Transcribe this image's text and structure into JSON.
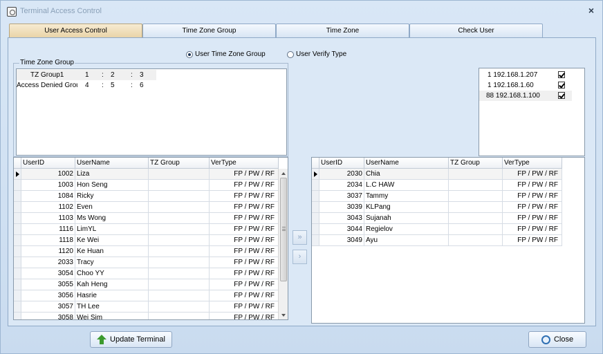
{
  "window": {
    "title": "Terminal Access Control"
  },
  "tabs": [
    {
      "label": "User Access Control",
      "active": true
    },
    {
      "label": "Time Zone Group",
      "active": false
    },
    {
      "label": "Time Zone",
      "active": false
    },
    {
      "label": "Check User",
      "active": false
    }
  ],
  "radios": {
    "tz_group": {
      "label": "User Time Zone Group",
      "selected": true
    },
    "verify_type": {
      "label": "User Verify Type",
      "selected": false
    }
  },
  "time_zone_group": {
    "label": "Time Zone Group",
    "rows": [
      {
        "name": "TZ Group1",
        "a": "1",
        "sep1": ":",
        "b": "2",
        "sep2": ":",
        "c": "3"
      },
      {
        "name": "Access Denied Grou",
        "a": "4",
        "sep1": ":",
        "b": "5",
        "sep2": ":",
        "c": "6"
      }
    ]
  },
  "terminals": [
    {
      "id": "1",
      "ip": "192.168.1.207",
      "checked": true
    },
    {
      "id": "1",
      "ip": "192.168.1.60",
      "checked": true
    },
    {
      "id": "88",
      "ip": "192.168.1.100",
      "checked": true
    }
  ],
  "grid_columns": {
    "userid": "UserID",
    "username": "UserName",
    "tzgroup": "TZ Group",
    "vertype": "VerType"
  },
  "left_users": [
    {
      "id": "1002",
      "name": "Liza",
      "tz": "",
      "vt": "FP / PW / RF"
    },
    {
      "id": "1003",
      "name": "Hon Seng",
      "tz": "",
      "vt": "FP / PW / RF"
    },
    {
      "id": "1084",
      "name": "Ricky",
      "tz": "",
      "vt": "FP / PW / RF"
    },
    {
      "id": "1102",
      "name": "Even",
      "tz": "",
      "vt": "FP / PW / RF"
    },
    {
      "id": "1103",
      "name": "Ms Wong",
      "tz": "",
      "vt": "FP / PW / RF"
    },
    {
      "id": "1116",
      "name": "LimYL",
      "tz": "",
      "vt": "FP / PW / RF"
    },
    {
      "id": "1118",
      "name": "Ke Wei",
      "tz": "",
      "vt": "FP / PW / RF"
    },
    {
      "id": "1120",
      "name": "Ke Huan",
      "tz": "",
      "vt": "FP / PW / RF"
    },
    {
      "id": "2033",
      "name": "Tracy",
      "tz": "",
      "vt": "FP / PW / RF"
    },
    {
      "id": "3054",
      "name": "Choo YY",
      "tz": "",
      "vt": "FP / PW / RF"
    },
    {
      "id": "3055",
      "name": "Kah Heng",
      "tz": "",
      "vt": "FP / PW / RF"
    },
    {
      "id": "3056",
      "name": "Hasrie",
      "tz": "",
      "vt": "FP / PW / RF"
    },
    {
      "id": "3057",
      "name": "TH Lee",
      "tz": "",
      "vt": "FP / PW / RF"
    },
    {
      "id": "3058",
      "name": "Wei Sim",
      "tz": "",
      "vt": "FP / PW / RF"
    }
  ],
  "right_users": [
    {
      "id": "2030",
      "name": "Chia",
      "tz": "",
      "vt": "FP / PW / RF"
    },
    {
      "id": "2034",
      "name": "L.C HAW",
      "tz": "",
      "vt": "FP / PW / RF"
    },
    {
      "id": "3037",
      "name": "Tammy",
      "tz": "",
      "vt": "FP / PW / RF"
    },
    {
      "id": "3039",
      "name": "KLPang",
      "tz": "",
      "vt": "FP / PW / RF"
    },
    {
      "id": "3043",
      "name": "Sujanah",
      "tz": "",
      "vt": "FP / PW / RF"
    },
    {
      "id": "3044",
      "name": "Regielov",
      "tz": "",
      "vt": "FP / PW / RF"
    },
    {
      "id": "3049",
      "name": "Ayu",
      "tz": "",
      "vt": "FP / PW / RF"
    }
  ],
  "move_buttons": {
    "move_all": "»",
    "move_one": "›"
  },
  "buttons": {
    "update": "Update Terminal",
    "close": "Close"
  }
}
